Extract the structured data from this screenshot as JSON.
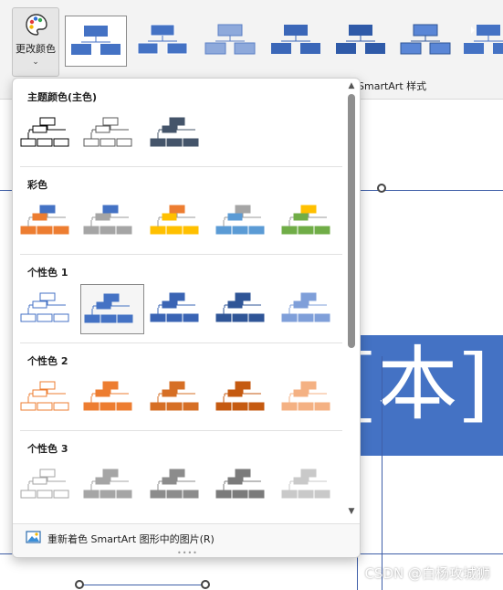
{
  "ribbon": {
    "change_colors_label": "更改颜色",
    "group_label": "SmartArt 样式",
    "styles": [
      "SmartArt 样式 1",
      "SmartArt 样式 2",
      "SmartArt 样式 3",
      "SmartArt 样式 4",
      "SmartArt 样式 5",
      "SmartArt 样式 6",
      "SmartArt 样式 7"
    ]
  },
  "slide": {
    "title_text": "[本]",
    "watermark": "CSDN @白杨攻城狮"
  },
  "dropdown": {
    "sections": [
      {
        "title": "主题颜色(主色)",
        "options": 3
      },
      {
        "title": "彩色",
        "options": 5
      },
      {
        "title": "个性色 1",
        "options": 5,
        "selected_index": 1
      },
      {
        "title": "个性色 2",
        "options": 5
      },
      {
        "title": "个性色 3",
        "options": 5
      }
    ],
    "recolor_label": "重新着色 SmartArt 图形中的图片(R)",
    "colors": {
      "theme": [
        "#000000",
        "#595959",
        "#44546a"
      ],
      "colorful": [
        [
          "#4472c4",
          "#ed7d31"
        ],
        [
          "#4472c4",
          "#a5a5a5"
        ],
        [
          "#ed7d31",
          "#ffc000"
        ],
        [
          "#a5a5a5",
          "#5b9bd5"
        ],
        [
          "#ffc000",
          "#70ad47"
        ]
      ],
      "accent1": [
        "#4472c4",
        "#4472c4",
        "#3a64b4",
        "#2f5597",
        "#7f9fd9"
      ],
      "accent2": [
        "#ed7d31",
        "#ed7d31",
        "#d66f25",
        "#c55a11",
        "#f4b183"
      ],
      "accent3": [
        "#a5a5a5",
        "#a5a5a5",
        "#8c8c8c",
        "#7b7b7b",
        "#c9c9c9"
      ]
    }
  }
}
